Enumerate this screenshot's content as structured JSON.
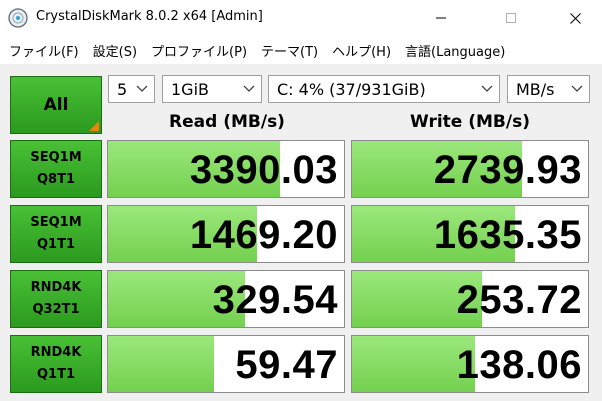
{
  "window": {
    "title": "CrystalDiskMark 8.0.2 x64 [Admin]"
  },
  "menu": [
    "ファイル(F)",
    "設定(S)",
    "プロファイル(P)",
    "テーマ(T)",
    "ヘルプ(H)",
    "言語(Language)"
  ],
  "controls": {
    "all_label": "All",
    "count": "5",
    "size": "1GiB",
    "drive": "C: 4% (37/931GiB)",
    "unit": "MB/s"
  },
  "headers": {
    "read": "Read (MB/s)",
    "write": "Write (MB/s)"
  },
  "tests": [
    {
      "line1": "SEQ1M",
      "line2": "Q8T1",
      "read": "3390.03",
      "write": "2739.93",
      "read_fill_pct": 73,
      "write_fill_pct": 72
    },
    {
      "line1": "SEQ1M",
      "line2": "Q1T1",
      "read": "1469.20",
      "write": "1635.35",
      "read_fill_pct": 63,
      "write_fill_pct": 69
    },
    {
      "line1": "RND4K",
      "line2": "Q32T1",
      "read": "329.54",
      "write": "253.72",
      "read_fill_pct": 58,
      "write_fill_pct": 55
    },
    {
      "line1": "RND4K",
      "line2": "Q1T1",
      "read": "59.47",
      "write": "138.06",
      "read_fill_pct": 45,
      "write_fill_pct": 52
    }
  ],
  "colors": {
    "green_button": "#2b9a1f",
    "bar_fill": "#74d04f",
    "corner_accent": "#f0820a"
  }
}
